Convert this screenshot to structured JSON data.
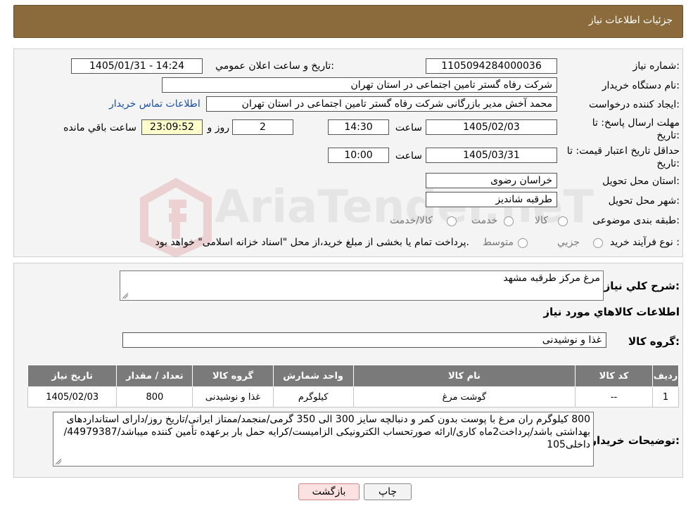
{
  "header": {
    "title": "جزئیات اطلاعات نیاز"
  },
  "labels": {
    "need_number": "شماره نیاز:",
    "announce_datetime": "تاریخ و ساعت اعلان عمومي:",
    "buyer_org": "نام دستگاه خریدار:",
    "requester": "ایجاد کننده درخواست:",
    "reply_deadline": "مهلت ارسال پاسخ: تا تاریخ:",
    "price_validity": "حداقل تاریخ اعتبار قیمت: تا تاریخ:",
    "time": "ساعت",
    "day_and": "روز و",
    "remaining": "ساعت باقي مانده",
    "delivery_province": "استان محل تحویل:",
    "delivery_city": "شهر محل تحویل:",
    "category": "طبقه بندی موضوعی:",
    "process_type": "نوع فرآیند خرید :",
    "need_description": "شرح کلي نیاز:",
    "goods_info": "اطلاعات کالاهاي مورد نیاز",
    "goods_group": "گروه کالا:",
    "buyer_notes": "توضیحات خریدار:"
  },
  "values": {
    "need_number": "1105094284000036",
    "announce_datetime": "1405/01/31 - 14:24",
    "buyer_org": "شرکت رفاه گستر تامین اجتماعی در استان تهران",
    "requester": "محمد آخش مدیر بازرگانی شرکت رفاه گستر تامین اجتماعی در استان تهران",
    "contact_link": "اطلاعات تماس خریدار",
    "reply_date": "1405/02/03",
    "reply_time": "14:30",
    "reply_days": "2",
    "reply_remaining": "23:09:52",
    "validity_date": "1405/03/31",
    "validity_time": "10:00",
    "province": "خراسان رضوی",
    "city": "طرقبه شاندیز",
    "need_description": "مرغ مرکز طرقبه مشهد",
    "goods_group": "غذا و نوشیدنی",
    "buyer_notes": "800 کیلوگرم ران مرغ با پوست بدون کمر و دنبالچه سایز 300 الی 350 گرمی/منجمد/ممتاز ایرانی/تاریخ روز/دارای استانداردهای بهداشتی باشد/پرداخت2ماه کاری/ارائه صورتحساب الکترونیکی الزامیست/کرایه حمل بار برعهده تأمین کننده میباشد/44979387/داخلی105"
  },
  "category_options": [
    "کالا",
    "خدمت",
    "کالا/خدمت"
  ],
  "process_options": [
    "جزیي",
    "متوسط"
  ],
  "process_note": "پرداخت تمام یا بخشی از مبلغ خرید،از محل \"اسناد خزانه اسلامی\" خواهد بود.",
  "table": {
    "headers": [
      "ردیف",
      "کد کالا",
      "نام کالا",
      "واحد شمارش",
      "گروه کالا",
      "تعداد / مقدار",
      "تاریخ نیاز"
    ],
    "rows": [
      [
        "1",
        "--",
        "گوشت مرغ",
        "کیلوگرم",
        "غذا و نوشیدنی",
        "800",
        "1405/02/03"
      ]
    ]
  },
  "buttons": {
    "print": "چاپ",
    "back": "بازگشت"
  },
  "watermark": {
    "text": "AriaTender.neT"
  },
  "colors": {
    "header_bg": "#8b6b3c",
    "table_header_bg": "#7a7a7a",
    "link": "#1a4fa3",
    "back_button_bg": "#fbe1e1",
    "remaining_bg": "#ffffcc"
  }
}
